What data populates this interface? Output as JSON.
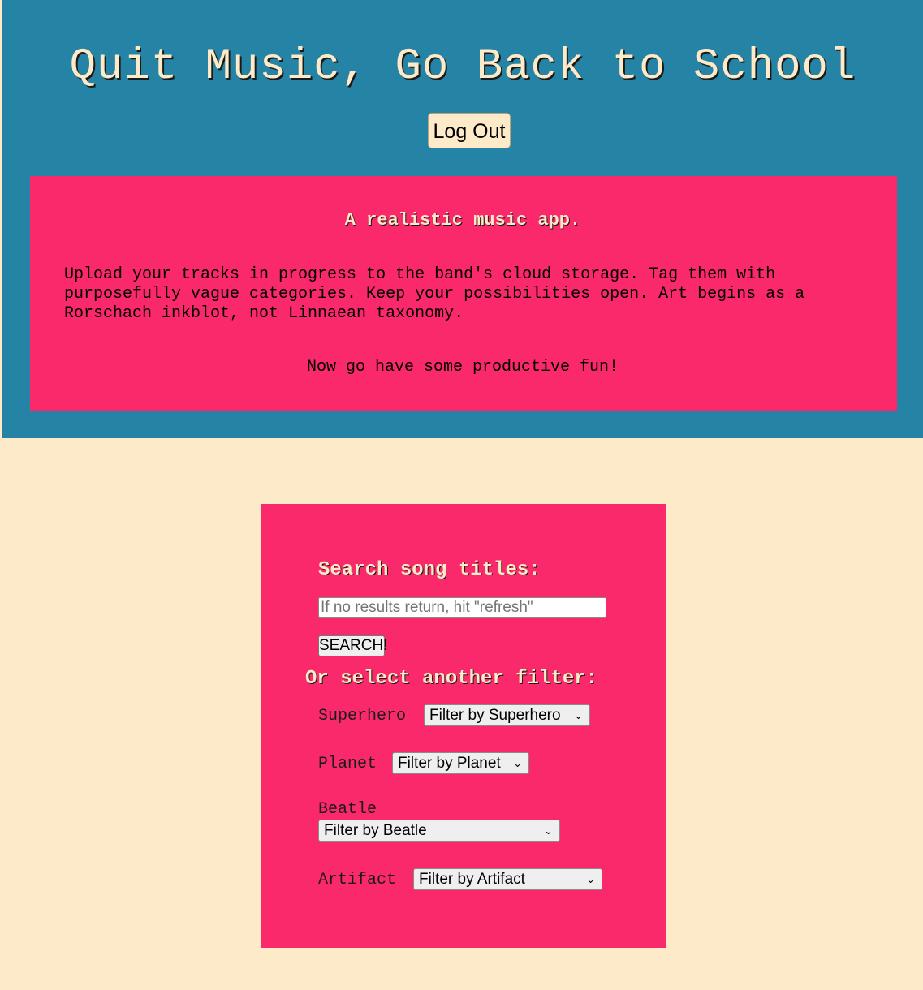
{
  "header": {
    "title": "Quit Music, Go Back to School",
    "logout_label": "Log Out"
  },
  "intro": {
    "tagline": "A realistic music app.",
    "body": "Upload your tracks in progress to the band's cloud storage. Tag them with purposefully vague categories. Keep your possibilities open. Art begins as a Rorschach inkblot, not Linnaean taxonomy.",
    "closing": "Now go have some productive fun!"
  },
  "search": {
    "heading": "Search song titles:",
    "placeholder": "If no results return, hit \"refresh\"",
    "value": "",
    "button_label": "SEARCH!"
  },
  "filters": {
    "heading": "Or select another filter:",
    "superhero": {
      "label": "Superhero",
      "selected": "Filter by Superhero"
    },
    "planet": {
      "label": "Planet",
      "selected": "Filter by Planet"
    },
    "beatle": {
      "label": "Beatle",
      "selected": "Filter by Beatle"
    },
    "artifact": {
      "label": "Artifact",
      "selected": "Filter by Artifact"
    }
  },
  "colors": {
    "header_bg": "#2584a5",
    "accent_pink": "#f9296b",
    "cream": "#fdeac8"
  },
  "icons": {
    "select_arrow": "chevron-down-icon"
  }
}
